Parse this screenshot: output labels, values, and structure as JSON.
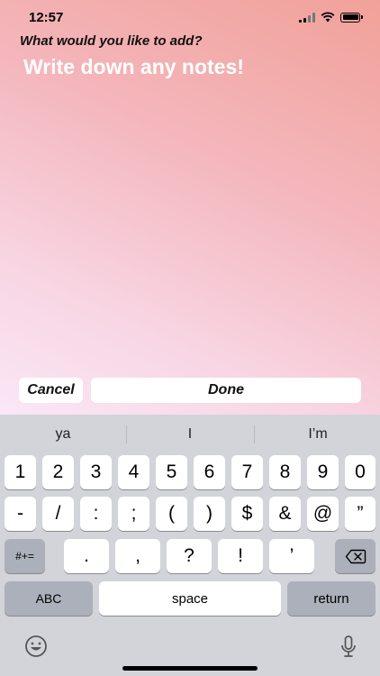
{
  "status_bar": {
    "time": "12:57"
  },
  "prompt": "What would you like to add?",
  "notes": {
    "placeholder": "Write down any notes!",
    "value": ""
  },
  "buttons": {
    "cancel": "Cancel",
    "done": "Done"
  },
  "keyboard": {
    "suggestions": [
      "ya",
      "I",
      "I’m"
    ],
    "row1": [
      "1",
      "2",
      "3",
      "4",
      "5",
      "6",
      "7",
      "8",
      "9",
      "0"
    ],
    "row2": [
      "-",
      "/",
      ":",
      ";",
      "(",
      ")",
      "$",
      "&",
      "@",
      "”"
    ],
    "row3": {
      "symbols_toggle": "#+=",
      "keys": [
        ".",
        ",",
        "?",
        "!",
        "’"
      ]
    },
    "row4": {
      "abc": "ABC",
      "space": "space",
      "return": "return"
    }
  },
  "colors": {
    "gradient_top": "#f1a199",
    "gradient_bottom": "#fae7f6",
    "keyboard_bg": "#d2d4da"
  }
}
